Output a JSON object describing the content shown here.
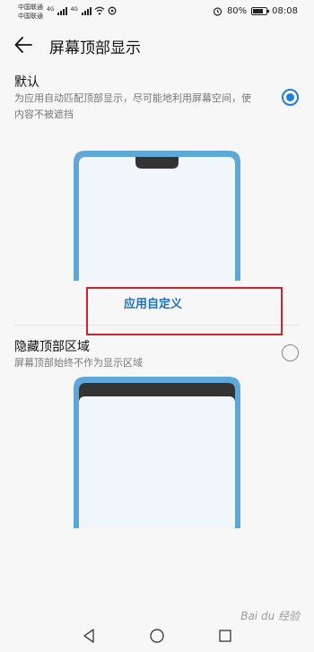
{
  "status_bar": {
    "carrier_1": "中国联通",
    "carrier_2": "中国联通",
    "network_tag_1": "4G",
    "network_tag_2": "4G",
    "battery_percent": "80%",
    "battery_level": 0.8,
    "time": "08:08",
    "icons": [
      "signal-icon",
      "signal-icon",
      "wifi-icon",
      "data-saver-icon",
      "alarm-icon",
      "battery-icon"
    ]
  },
  "header": {
    "back_icon": "arrow-left-icon",
    "title": "屏幕顶部显示"
  },
  "options": [
    {
      "title": "默认",
      "description": "为应用自动匹配顶部显示，尽可能地利用屏幕空间，使内容不被遮挡",
      "selected": true
    },
    {
      "title": "隐藏顶部区域",
      "description": "屏幕顶部始终不作为显示区域",
      "selected": false
    }
  ],
  "app_custom_label": "应用自定义",
  "watermark": "Bai du 经验",
  "colors": {
    "accent": "#1f7ce0",
    "phone_frame": "#5ea7d8",
    "phone_screen": "#f1f6fb",
    "notch": "#333333",
    "highlight": "#d0242c"
  },
  "nav_bar": {
    "icons": [
      "back-triangle-icon",
      "home-circle-icon",
      "recents-square-icon"
    ]
  }
}
